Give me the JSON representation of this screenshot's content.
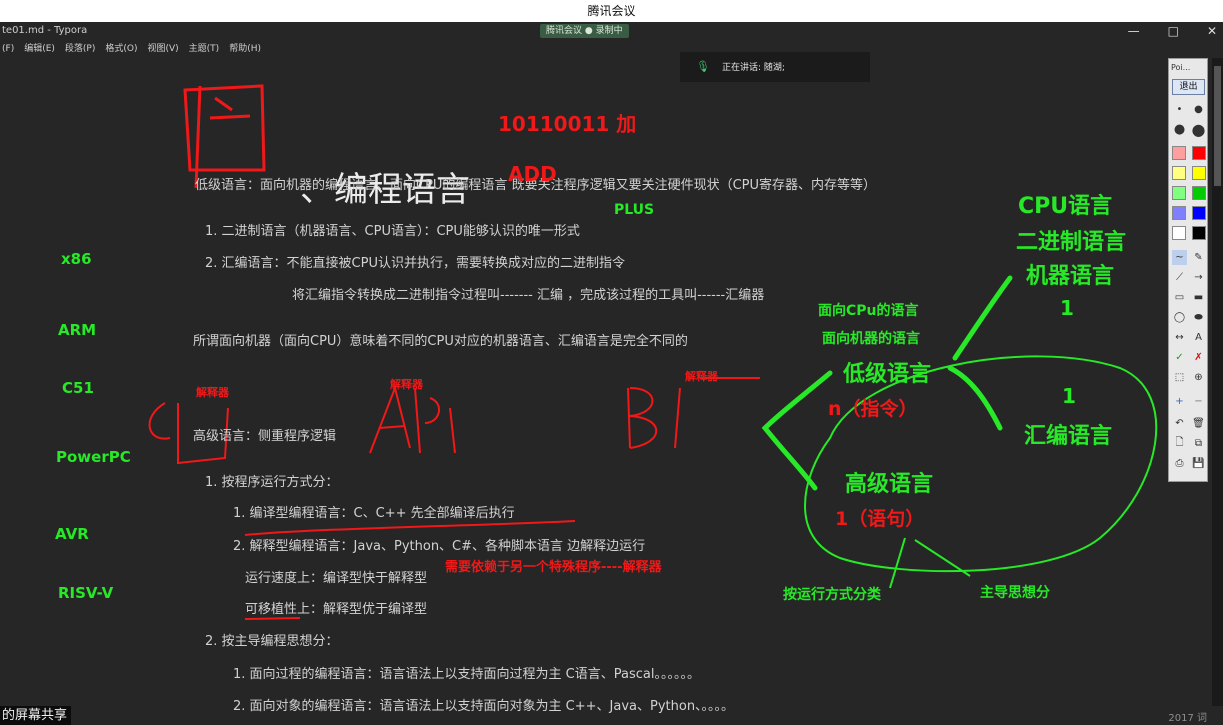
{
  "meeting": {
    "title": "腾讯会议",
    "badge": "腾讯会议 ● 录制中",
    "speaker_label": "正在讲话: 随湖;"
  },
  "window": {
    "app_title": "te01.md - Typora",
    "minimize": "—",
    "maximize": "□",
    "close": "✕"
  },
  "menu": [
    "(F)",
    "编辑(E)",
    "段落(P)",
    "格式(O)",
    "视图(V)",
    "主题(T)",
    "帮助(H)"
  ],
  "doc": {
    "heading": "、编程语言",
    "low_level_intro": "低级语言：面向机器的编程语言、面向CPU的编程语言 既要关注程序逻辑又要关注硬件现状（CPU寄存器、内存等等）",
    "low_items": [
      "1. 二进制语言（机器语言、CPU语言）：CPU能够认识的唯一形式",
      "2. 汇编语言：不能直接被CPU认识并执行，需要转换成对应的二进制指令"
    ],
    "asm_note": "将汇编指令转换成二进制指令过程叫------- 汇编 ，完成该过程的工具叫------汇编器",
    "machine_note": "所谓面向机器（面向CPU）意味着不同的CPU对应的机器语言、汇编语言是完全不同的",
    "high_level": "高级语言：侧重程序逻辑",
    "by_run": "1. 按程序运行方式分：",
    "run_items": [
      "1. 编译型编程语言：C、C++  先全部编译后执行",
      "2. 解释型编程语言：Java、Python、C#、各种脚本语言  边解释边运行"
    ],
    "speed_note": "运行速度上：编译型快于解释型",
    "port_note": "可移植性上：解释型优于编译型",
    "by_paradigm": "2. 按主导编程思想分：",
    "paradigm_items": [
      "1. 面向过程的编程语言：语言语法上以支持面向过程为主    C语言、Pascal。。。。。。",
      "2. 面向对象的编程语言：语言语法上以支持面向对象为主    C++、Java、Python、。。。。"
    ]
  },
  "annotations": {
    "binary_add": "10110011 加",
    "add": "ADD",
    "plus": "PLUS",
    "cpu_lang": "CPU语言",
    "binary_lang": "二进制语言",
    "machine_lang": "机器语言",
    "one_a": "1",
    "cpu_facing": "面向CPu的语言",
    "machine_facing": "面向机器的语言",
    "low_level": "低级语言",
    "n_instr": "n（指令）",
    "one_b": "1",
    "asm_lang": "汇编语言",
    "high_level": "高级语言",
    "one_stmt": "1（语句）",
    "by_run_mode": "按运行方式分类",
    "by_paradigm": "主导思想分",
    "interp_note": "需要依赖于另一个特殊程序----解释器",
    "interpreter_1": "解释器",
    "interpreter_2": "解释器",
    "interpreter_3": "解释器"
  },
  "architectures": [
    "x86",
    "ARM",
    "C51",
    "PowerPC",
    "AVR",
    "RISV-V"
  ],
  "toolbar": {
    "head": "Poi...",
    "exit": "退出",
    "colors": [
      "#ff9e9e",
      "#ff0000",
      "#ffff80",
      "#ffff00",
      "#80ff80",
      "#00cc00",
      "#8080ff",
      "#0000ff",
      "#ffffff",
      "#000000"
    ]
  },
  "footer": {
    "share_label": "的屏幕共享",
    "stamp": "2017 词"
  }
}
